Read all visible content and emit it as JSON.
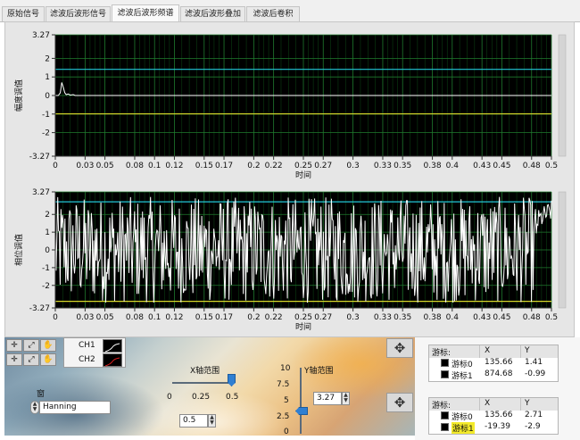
{
  "tabs": [
    {
      "label": "原始信号",
      "active": false
    },
    {
      "label": "滤波后波形信号",
      "active": false
    },
    {
      "label": "滤波后波形频谱",
      "active": true
    },
    {
      "label": "滤波后波形叠加",
      "active": false
    },
    {
      "label": "滤波后卷积",
      "active": false
    }
  ],
  "chart_data": [
    {
      "type": "line",
      "ylabel": "幅度调值",
      "xlabel": "时间",
      "xlim": [
        0,
        0.5
      ],
      "ylim": [
        -3.27,
        3.27
      ],
      "x_ticks": [
        "0",
        "0.03",
        "0.05",
        "0.08",
        "0.1",
        "0.12",
        "0.15",
        "0.17",
        "0.2",
        "0.22",
        "0.25",
        "0.27",
        "0.3",
        "0.33",
        "0.35",
        "0.38",
        "0.4",
        "0.43",
        "0.45",
        "0.48",
        "0.5"
      ],
      "y_ticks": [
        "3.27",
        "2",
        "1",
        "0",
        "-1",
        "-2",
        "-3.27"
      ],
      "grid": true,
      "cursors": [
        {
          "name": "游标0",
          "y": 1.41,
          "color": "#22c7d8"
        },
        {
          "name": "游标1",
          "y": -0.99,
          "color": "#d8d82a"
        }
      ],
      "series": [
        {
          "x": [
            0,
            0.003,
            0.005,
            0.0065,
            0.008,
            0.0095,
            0.011,
            0.013,
            0.015,
            0.018,
            0.02,
            0.5
          ],
          "y": [
            0,
            0,
            0.15,
            0.7,
            0.45,
            0.15,
            0.05,
            0.08,
            0.02,
            0.05,
            0,
            0
          ]
        }
      ]
    },
    {
      "type": "line",
      "ylabel": "相位调值",
      "xlabel": "时间",
      "xlim": [
        0,
        0.5
      ],
      "ylim": [
        -3.27,
        3.27
      ],
      "x_ticks": [
        "0",
        "0.03",
        "0.05",
        "0.08",
        "0.1",
        "0.12",
        "0.15",
        "0.17",
        "0.2",
        "0.22",
        "0.25",
        "0.27",
        "0.3",
        "0.33",
        "0.35",
        "0.38",
        "0.4",
        "0.43",
        "0.45",
        "0.48",
        "0.5"
      ],
      "y_ticks": [
        "3.27",
        "2",
        "1",
        "0",
        "-1",
        "-2",
        "-3.27"
      ],
      "grid": true,
      "cursors": [
        {
          "name": "游标0",
          "y": 2.71,
          "color": "#22c7d8"
        },
        {
          "name": "游标1",
          "y": -2.9,
          "color": "#d8d82a"
        }
      ],
      "series": [
        {
          "noise_amplitude": 3.0
        }
      ]
    }
  ],
  "controls": {
    "channels": [
      {
        "label": "CH1",
        "color": "#ffffff"
      },
      {
        "label": "CH2",
        "color": "#e02020"
      }
    ],
    "x_range": {
      "label": "X轴范围",
      "ticks": [
        "0",
        "0.25",
        "0.5"
      ],
      "value": "0.5",
      "slider_value": 0.5
    },
    "y_range": {
      "label": "Y轴范围",
      "ticks": [
        "10",
        "7.5",
        "5",
        "2.5",
        "0"
      ],
      "value": "3.27",
      "slider_value": 3.27
    },
    "window": {
      "label": "窗",
      "value": "Hanning"
    }
  },
  "cursor_tables": [
    {
      "title": "游标:",
      "col_x": "X",
      "col_y": "Y",
      "rows": [
        {
          "name": "游标0",
          "x": "135.66",
          "y": "1.41",
          "highlight": false
        },
        {
          "name": "游标1",
          "x": "874.68",
          "y": "-0.99",
          "highlight": false
        }
      ]
    },
    {
      "title": "游标:",
      "col_x": "X",
      "col_y": "Y",
      "rows": [
        {
          "name": "游标0",
          "x": "135.66",
          "y": "2.71",
          "highlight": false
        },
        {
          "name": "游标1",
          "x": "-19.39",
          "y": "-2.9",
          "highlight": true
        }
      ]
    }
  ]
}
